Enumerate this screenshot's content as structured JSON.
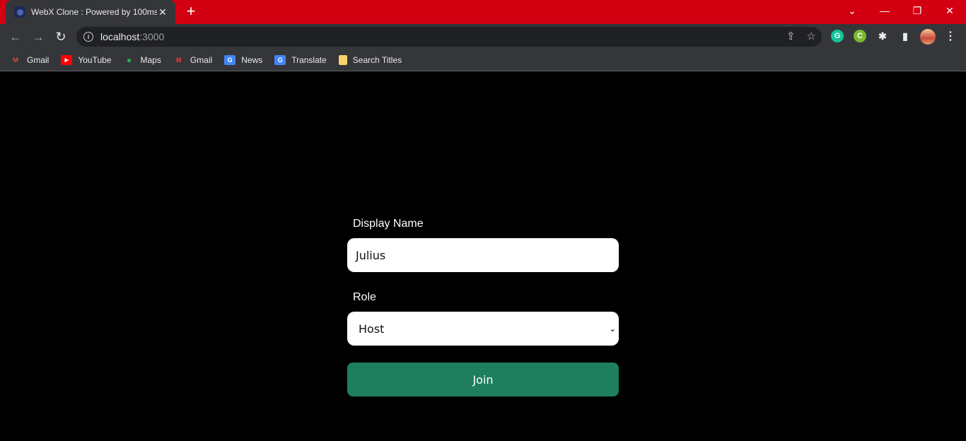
{
  "browser": {
    "tab": {
      "title": "WebX Clone : Powered by 100ms",
      "favicon": "webx-favicon-icon"
    },
    "new_tab": "+",
    "window_controls": {
      "tab_search": "⌄",
      "minimize": "—",
      "restore": "❐",
      "close": "✕"
    },
    "nav": {
      "back": "←",
      "forward": "→",
      "reload": "↻"
    },
    "address": {
      "host": "localhost",
      "port": ":3000"
    },
    "omnibox_icons": {
      "share": "⇪",
      "bookmark": "☆"
    },
    "extensions": {
      "grammarly": "G",
      "ext2": "C",
      "puzzle": "✱",
      "sidepanel": "▮",
      "menu": "⋮"
    },
    "bookmarks": [
      {
        "label": "Gmail",
        "icon": "gmail-icon",
        "color": "#ea4335",
        "glyph": "M"
      },
      {
        "label": "YouTube",
        "icon": "youtube-icon",
        "color": "#ff0000",
        "glyph": "▶"
      },
      {
        "label": "Maps",
        "icon": "maps-icon",
        "color": "#34a853",
        "glyph": "●"
      },
      {
        "label": "Gmail",
        "icon": "gmail-icon",
        "color": "#ea4335",
        "glyph": "M"
      },
      {
        "label": "News",
        "icon": "news-icon",
        "color": "#4285f4",
        "glyph": "G"
      },
      {
        "label": "Translate",
        "icon": "translate-icon",
        "color": "#4285f4",
        "glyph": "G"
      },
      {
        "label": "Search Titles",
        "icon": "folder-icon",
        "color": "#f6d46b",
        "glyph": ""
      }
    ]
  },
  "form": {
    "display_name_label": "Display Name",
    "display_name_value": "Julius",
    "role_label": "Role",
    "role_value": "Host",
    "join_label": "Join"
  },
  "colors": {
    "titlebar": "#d30012",
    "join_button": "#1e7f5f"
  }
}
